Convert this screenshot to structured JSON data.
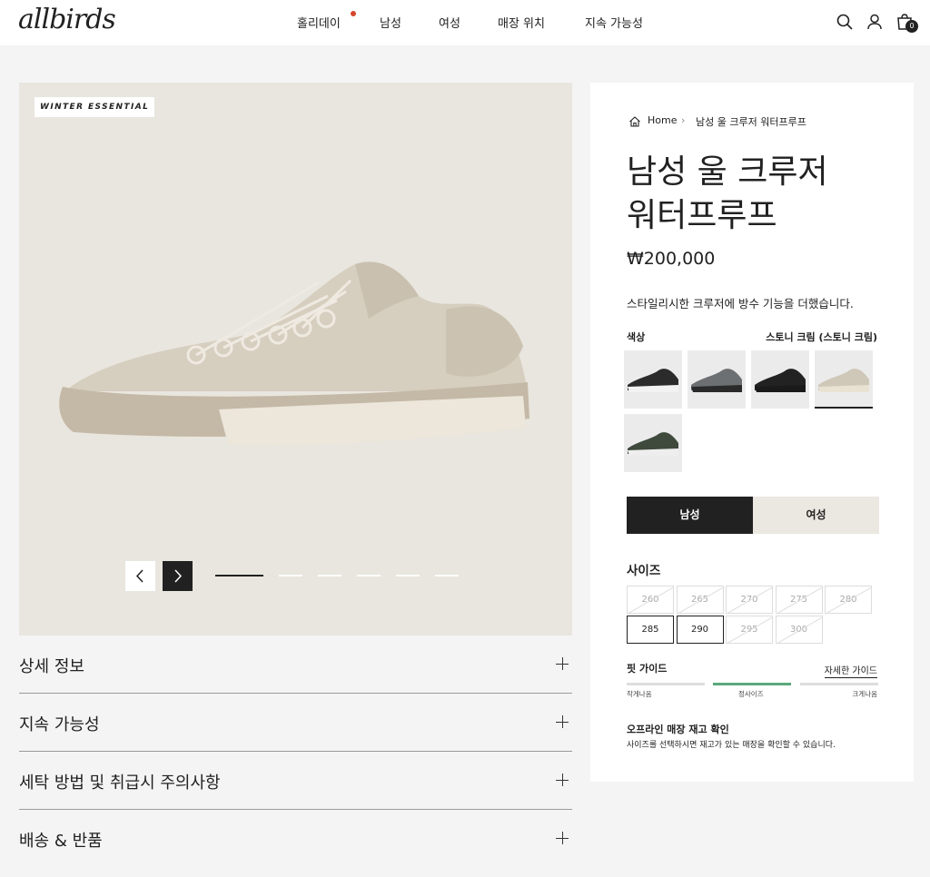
{
  "header": {
    "logo": "allbirds",
    "nav": [
      {
        "label": "홀리데이",
        "has_dot": true
      },
      {
        "label": "남성"
      },
      {
        "label": "여성"
      },
      {
        "label": "매장 위치"
      },
      {
        "label": "지속 가능성"
      }
    ],
    "icons": [
      "search-icon",
      "account-icon",
      "cart-icon"
    ],
    "cart_count": "0"
  },
  "gallery": {
    "badge": "WINTER ESSENTIAL",
    "current_slide": 1,
    "total_slides": 6,
    "product_color": "#d9d1c2"
  },
  "accordion": [
    "상세 정보",
    "지속 가능성",
    "세탁 방법 및 취급시 주의사항",
    "배송 & 반품"
  ],
  "product": {
    "breadcrumb": {
      "home": "Home",
      "current": "남성 울 크루저 워터프루프"
    },
    "title_line1": "남성 울 크루저",
    "title_line2": "워터프루프",
    "price": "₩200,000",
    "description": "스타일리시한 크루저에 방수 기능을 더했습니다.",
    "color_label": "색상",
    "color_value": "스토니 크림 (스토니 크림)",
    "swatches": [
      {
        "name": "black-white",
        "upper": "#2b2b2b",
        "sole": "#f2f2f2",
        "selected": false
      },
      {
        "name": "grey-black",
        "upper": "#6d7072",
        "sole": "#2a2a2a",
        "selected": false
      },
      {
        "name": "all-black",
        "upper": "#222222",
        "sole": "#1a1a1a",
        "selected": false
      },
      {
        "name": "stony-cream",
        "upper": "#cfc7b8",
        "sole": "#e9e2d3",
        "selected": true
      },
      {
        "name": "dark-olive",
        "upper": "#3f4a3d",
        "sole": "#eeeeee",
        "selected": false
      }
    ],
    "gender_tabs": [
      {
        "label": "남성",
        "active": true
      },
      {
        "label": "여성",
        "active": false
      }
    ],
    "size_heading": "사이즈",
    "sizes": [
      {
        "label": "260",
        "available": false
      },
      {
        "label": "265",
        "available": false
      },
      {
        "label": "270",
        "available": false
      },
      {
        "label": "275",
        "available": false
      },
      {
        "label": "280",
        "available": false
      },
      {
        "label": "285",
        "available": true
      },
      {
        "label": "290",
        "available": true
      },
      {
        "label": "295",
        "available": false
      },
      {
        "label": "300",
        "available": false
      }
    ],
    "fit_guide": {
      "heading": "핏 가이드",
      "link": "자세한 가이드",
      "labels": [
        "작게나옴",
        "정사이즈",
        "크게나옴"
      ],
      "active_index": 1
    },
    "offline": {
      "heading": "오프라인 매장 재고 확인",
      "text": "사이즈를 선택하시면 재고가 있는 매장을 확인할 수 있습니다."
    }
  }
}
